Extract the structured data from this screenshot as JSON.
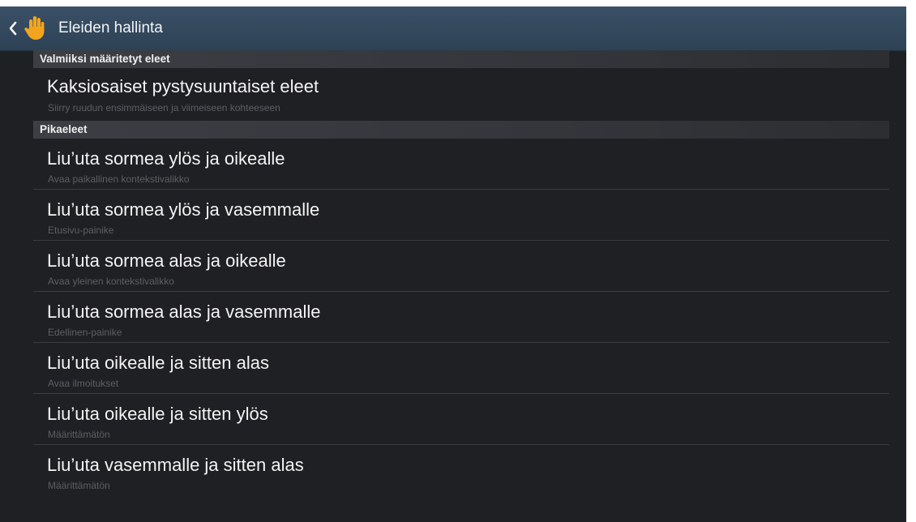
{
  "header": {
    "title": "Eleiden hallinta",
    "back_icon": "chevron-left-icon",
    "app_icon": "hand-icon",
    "accent": "#f2a51c"
  },
  "sections": [
    {
      "header": "Valmiiksi määritetyt eleet",
      "items": [
        {
          "title": "Kaksiosaiset pystysuuntaiset eleet",
          "subtitle": "Siirry ruudun ensimmäiseen ja viimeiseen kohteeseen"
        }
      ]
    },
    {
      "header": "Pikaeleet",
      "items": [
        {
          "title": "Liu’uta sormea ylös ja oikealle",
          "subtitle": "Avaa paikallinen kontekstivalikko"
        },
        {
          "title": "Liu’uta sormea ylös ja vasemmalle",
          "subtitle": "Etusivu-painike"
        },
        {
          "title": "Liu’uta sormea alas ja oikealle",
          "subtitle": "Avaa yleinen kontekstivalikko"
        },
        {
          "title": "Liu’uta sormea alas ja vasemmalle",
          "subtitle": "Edellinen-painike"
        },
        {
          "title": "Liu’uta oikealle ja sitten alas",
          "subtitle": "Avaa ilmoitukset"
        },
        {
          "title": "Liu’uta oikealle ja sitten ylös",
          "subtitle": "Määrittämätön"
        },
        {
          "title": "Liu’uta vasemmalle ja sitten alas",
          "subtitle": "Määrittämätön"
        }
      ]
    }
  ]
}
